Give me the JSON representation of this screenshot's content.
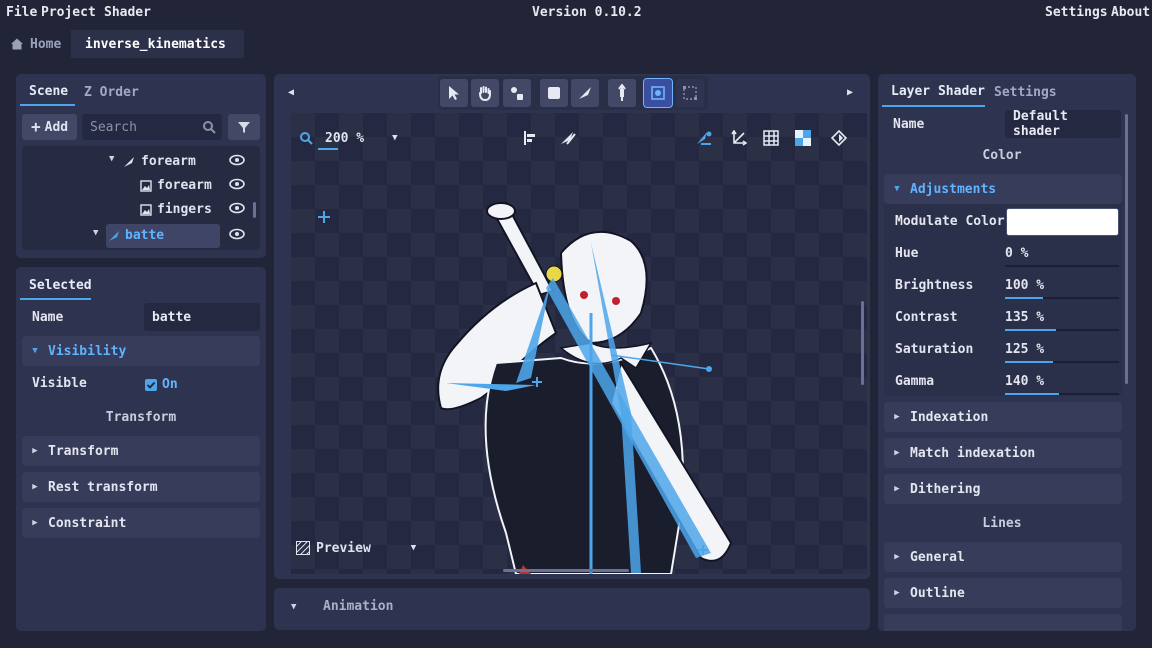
{
  "menu": {
    "file": "File",
    "project": "Project",
    "shader": "Shader",
    "version": "Version 0.10.2",
    "settings": "Settings",
    "about": "About"
  },
  "tabs": {
    "home": "Home",
    "active": "inverse_kinematics"
  },
  "scene_panel": {
    "tab_scene": "Scene",
    "tab_zorder": "Z Order",
    "add_label": "Add",
    "search_placeholder": "Search",
    "tree": [
      {
        "label": "forearm",
        "icon": "bone-icon",
        "expanded": true
      },
      {
        "label": "forearm",
        "icon": "image-icon"
      },
      {
        "label": "fingers",
        "icon": "image-icon"
      },
      {
        "label": "batte",
        "icon": "bone-icon",
        "expanded": true,
        "selected": true
      }
    ]
  },
  "selected_panel": {
    "tab": "Selected",
    "name_label": "Name",
    "name_value": "batte",
    "visibility_section": "Visibility",
    "visible_label": "Visible",
    "visible_value": "On",
    "visible_checked": true,
    "transform_header": "Transform",
    "sections": [
      "Transform",
      "Rest transform",
      "Constraint"
    ]
  },
  "viewport": {
    "zoom": "200 %",
    "preview_label": "Preview"
  },
  "animation": {
    "label": "Animation"
  },
  "shader_panel": {
    "tab_layer_shader": "Layer Shader",
    "tab_settings": "Settings",
    "name_label": "Name",
    "name_value": "Default shader",
    "color_header": "Color",
    "adjustments_section": "Adjustments",
    "modulate_label": "Modulate Color",
    "modulate_color": "#ffffff",
    "params": [
      {
        "label": "Hue",
        "value": "0 %",
        "fill": 0.0
      },
      {
        "label": "Brightness",
        "value": "100 %",
        "fill": 0.33
      },
      {
        "label": "Contrast",
        "value": "135 %",
        "fill": 0.45
      },
      {
        "label": "Saturation",
        "value": "125 %",
        "fill": 0.42
      },
      {
        "label": "Gamma",
        "value": "140 %",
        "fill": 0.47
      }
    ],
    "collapsed_sections": [
      "Indexation",
      "Match indexation",
      "Dithering"
    ],
    "lines_header": "Lines",
    "lines_sections": [
      "General",
      "Outline"
    ]
  },
  "colors": {
    "accent": "#4ea6ea",
    "bg": "#212537",
    "panel": "#2e3450"
  }
}
